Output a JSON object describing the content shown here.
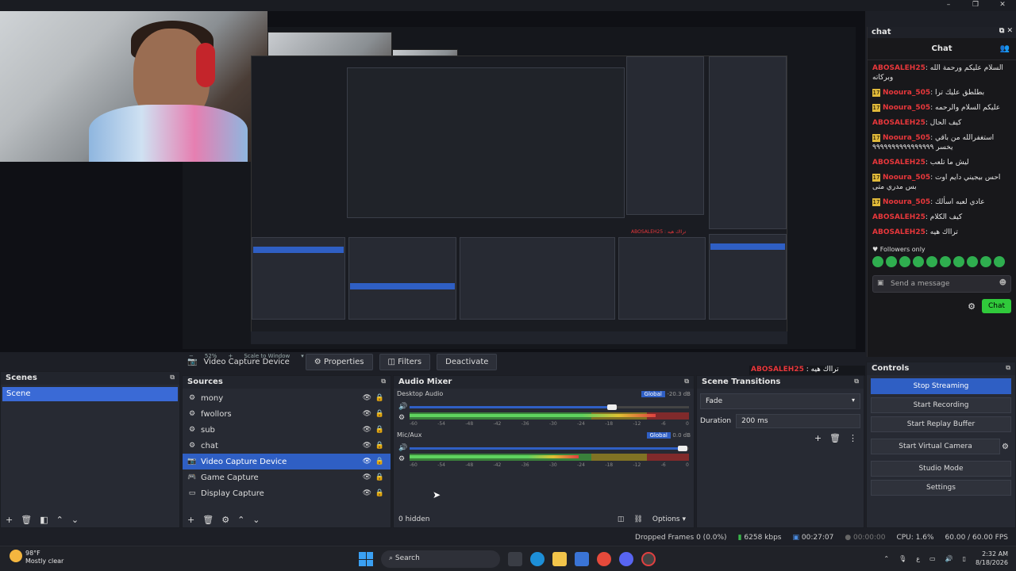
{
  "window": {
    "controls": [
      "–",
      "❐",
      "✕"
    ]
  },
  "preview": {
    "zoom": "52%",
    "scale_label": "Scale to Window",
    "nested_overlay_text": "ABOSALEH25 : ترااك هيه"
  },
  "source_toolbar": {
    "selected_source": "Video Capture Device",
    "properties_label": "Properties",
    "filters_label": "Filters",
    "deactivate_label": "Deactivate"
  },
  "overlay_name": {
    "user": "ABOSALEH25",
    "text": " : ترااك هيه"
  },
  "scenes": {
    "title": "Scenes",
    "items": [
      {
        "label": "Scene",
        "selected": true
      }
    ]
  },
  "sources": {
    "title": "Sources",
    "items": [
      {
        "label": "mony",
        "icon": "gear-icon"
      },
      {
        "label": "fwollors",
        "icon": "gear-icon"
      },
      {
        "label": "sub",
        "icon": "gear-icon"
      },
      {
        "label": "chat",
        "icon": "gear-icon"
      },
      {
        "label": "Video Capture Device",
        "icon": "camera-icon",
        "selected": true
      },
      {
        "label": "Game Capture",
        "icon": "gamepad-icon"
      },
      {
        "label": "Display Capture",
        "icon": "monitor-icon"
      }
    ]
  },
  "mixer": {
    "title": "Audio Mixer",
    "channels": [
      {
        "name": "Desktop Audio",
        "badge": "Global",
        "db": "-20.3 dB",
        "volume": 0.74,
        "level": 0.9
      },
      {
        "name": "Mic/Aux",
        "badge": "Global",
        "db": "0.0 dB",
        "volume": 1.0,
        "level": 0.62
      }
    ],
    "ticks": [
      "-60",
      "-54",
      "-48",
      "-42",
      "-36",
      "-30",
      "-24",
      "-18",
      "-12",
      "-6",
      "0"
    ],
    "hidden_label": "0 hidden",
    "options_label": "Options"
  },
  "transitions": {
    "title": "Scene Transitions",
    "selected": "Fade",
    "duration_label": "Duration",
    "duration_value": "200 ms"
  },
  "controls": {
    "title": "Controls",
    "buttons": [
      {
        "label": "Stop Streaming",
        "active": true
      },
      {
        "label": "Start Recording"
      },
      {
        "label": "Start Replay Buffer"
      },
      {
        "label": "Start Virtual Camera"
      },
      {
        "label": "Studio Mode"
      },
      {
        "label": "Settings"
      }
    ]
  },
  "chat": {
    "dock_title": "chat",
    "title": "Chat",
    "messages": [
      {
        "user": "ABOSALEH25",
        "badge": false,
        "text": ": السلام عليكم ورحمة الله وبركاته"
      },
      {
        "user": "Nooura_505",
        "badge": true,
        "text": ": بطلطق عليك ترا"
      },
      {
        "user": "Nooura_505",
        "badge": true,
        "text": ": عليكم السلام والرحمه"
      },
      {
        "user": "ABOSALEH25",
        "badge": false,
        "text": ": كيف الحال"
      },
      {
        "user": "Nooura_505",
        "badge": true,
        "text": ": استغفرالله من باقي يخسر ٩٩٩٩٩٩٩٩٩٩٩٩٩٩٩٩"
      },
      {
        "user": "ABOSALEH25",
        "badge": false,
        "text": ": ليش ما تلعب"
      },
      {
        "user": "Nooura_505",
        "badge": true,
        "text": ": احس بيجيني دايم اوت بس مدري متى"
      },
      {
        "user": "Nooura_505",
        "badge": true,
        "text": ": عادي لعبه اسألك"
      },
      {
        "user": "ABOSALEH25",
        "badge": false,
        "text": ": كيف الكلام"
      },
      {
        "user": "ABOSALEH25",
        "badge": false,
        "text": ": ترااك هيه"
      }
    ],
    "followers_label": "Followers only",
    "input_placeholder": "Send a message",
    "send_label": "Chat"
  },
  "statusbar": {
    "dropped": "Dropped Frames 0 (0.0%)",
    "bitrate": "6258 kbps",
    "stream_time": "00:27:07",
    "rec_time": "00:00:00",
    "cpu": "CPU: 1.6%",
    "fps": "60.00 / 60.00 FPS"
  },
  "taskbar": {
    "temp": "98°F",
    "weather": "Mostly clear",
    "search": "Search",
    "time": "2:32 AM",
    "date": "8/18/2026",
    "lang": "ع"
  }
}
